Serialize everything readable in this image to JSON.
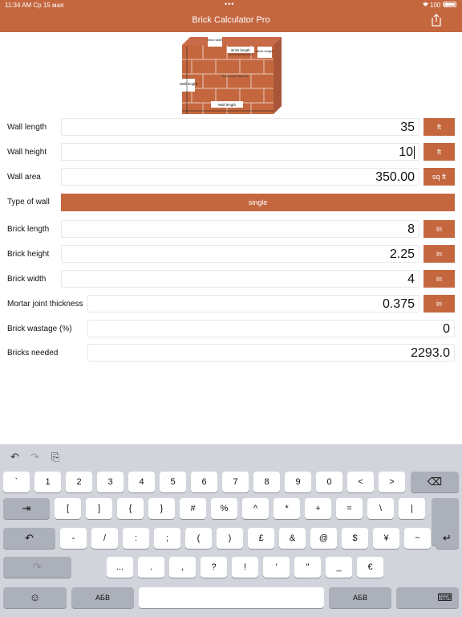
{
  "status_bar": {
    "time": "11:34 AM",
    "date": "Ср 15 мая",
    "battery": "100 %",
    "dots": "•••"
  },
  "header": {
    "title": "Brick Calculator Pro"
  },
  "illustration": {
    "labels": [
      "Brick width",
      "Brick length",
      "Brick height",
      "Wall height",
      "Wall length",
      "Mortar joint thickness"
    ]
  },
  "form": {
    "wall_length": {
      "label": "Wall length",
      "value": "35",
      "unit": "ft"
    },
    "wall_height": {
      "label": "Wall height",
      "value": "10",
      "unit": "ft"
    },
    "wall_area": {
      "label": "Wall area",
      "value": "350.00",
      "unit": "sq ft"
    },
    "wall_type": {
      "label": "Type of wall",
      "value": "single"
    },
    "brick_length": {
      "label": "Brick length",
      "value": "8",
      "unit": "in"
    },
    "brick_height": {
      "label": "Brick height",
      "value": "2.25",
      "unit": "in"
    },
    "brick_width": {
      "label": "Brick width",
      "value": "4",
      "unit": "in"
    },
    "mortar": {
      "label": "Mortar joint thickness",
      "value": "0.375",
      "unit": "in"
    },
    "wastage": {
      "label": "Brick wastage (%)",
      "value": "0"
    },
    "bricks_needed": {
      "label": "Bricks needed",
      "value": "2293.0"
    }
  },
  "keyboard": {
    "toolbar": {
      "undo": "↶",
      "redo": "↷",
      "paste": "⎘"
    },
    "row1": [
      "`",
      "1",
      "2",
      "3",
      "4",
      "5",
      "6",
      "7",
      "8",
      "9",
      "0",
      "<",
      ">"
    ],
    "row1_delete": "⌫",
    "row2_tab": "⇥",
    "row2": [
      "[",
      "]",
      "{",
      "}",
      "#",
      "%",
      "^",
      "*",
      "+",
      "=",
      "\\",
      "|"
    ],
    "row3_undo": "↶",
    "row3": [
      "-",
      "/",
      ":",
      ";",
      "(",
      ")",
      "£",
      "&",
      "@",
      "$",
      "¥",
      "~"
    ],
    "row3_return": "↵",
    "row4_redo": "↷",
    "row4": [
      "...",
      ".",
      ",",
      "?",
      "!",
      "′",
      "″",
      "_",
      "€"
    ],
    "row5_emoji": "☺",
    "row5_left_abc": "АБВ",
    "row5_right_abc": "АБВ",
    "row5_hide": "⌨"
  },
  "colors": {
    "accent": "#c4673f",
    "keyboard_bg": "#d1d4da"
  }
}
